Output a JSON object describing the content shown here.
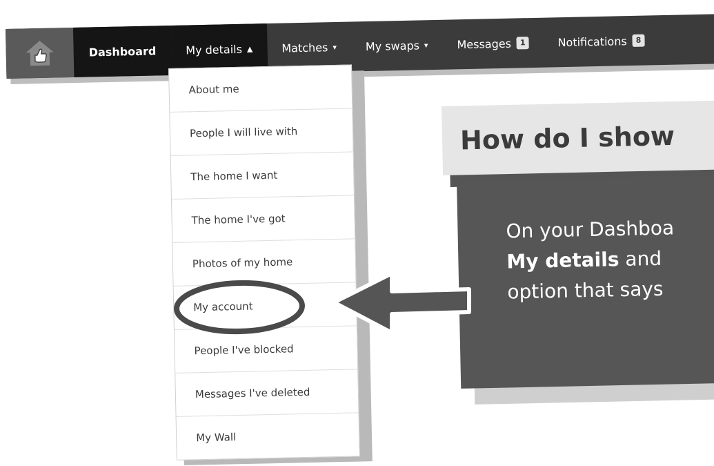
{
  "nav": {
    "home_icon": "thumbs-up-house-icon",
    "items": [
      {
        "label": "Dashboard"
      },
      {
        "label": "My details",
        "caret": "▲"
      },
      {
        "label": "Matches",
        "caret": "▾"
      },
      {
        "label": "My swaps",
        "caret": "▾"
      },
      {
        "label": "Messages",
        "badge": "1"
      },
      {
        "label": "Notifications",
        "badge": "8"
      }
    ]
  },
  "dropdown": {
    "items": [
      "About me",
      "People I will live with",
      "The home I want",
      "The home I've got",
      "Photos of my home",
      "My account",
      "People I've blocked",
      "Messages I've deleted",
      "My Wall"
    ],
    "highlighted_index": 5
  },
  "headline": "How do I show",
  "instruction": {
    "line1": "On your Dashboa",
    "line2_bold": "My details",
    "line2_rest": " and",
    "line3": "option that says"
  },
  "colors": {
    "nav_bg": "#3b3b3b",
    "nav_active": "#151515",
    "accent_dark": "#565656",
    "highlight_gray": "#4a4a4a"
  }
}
